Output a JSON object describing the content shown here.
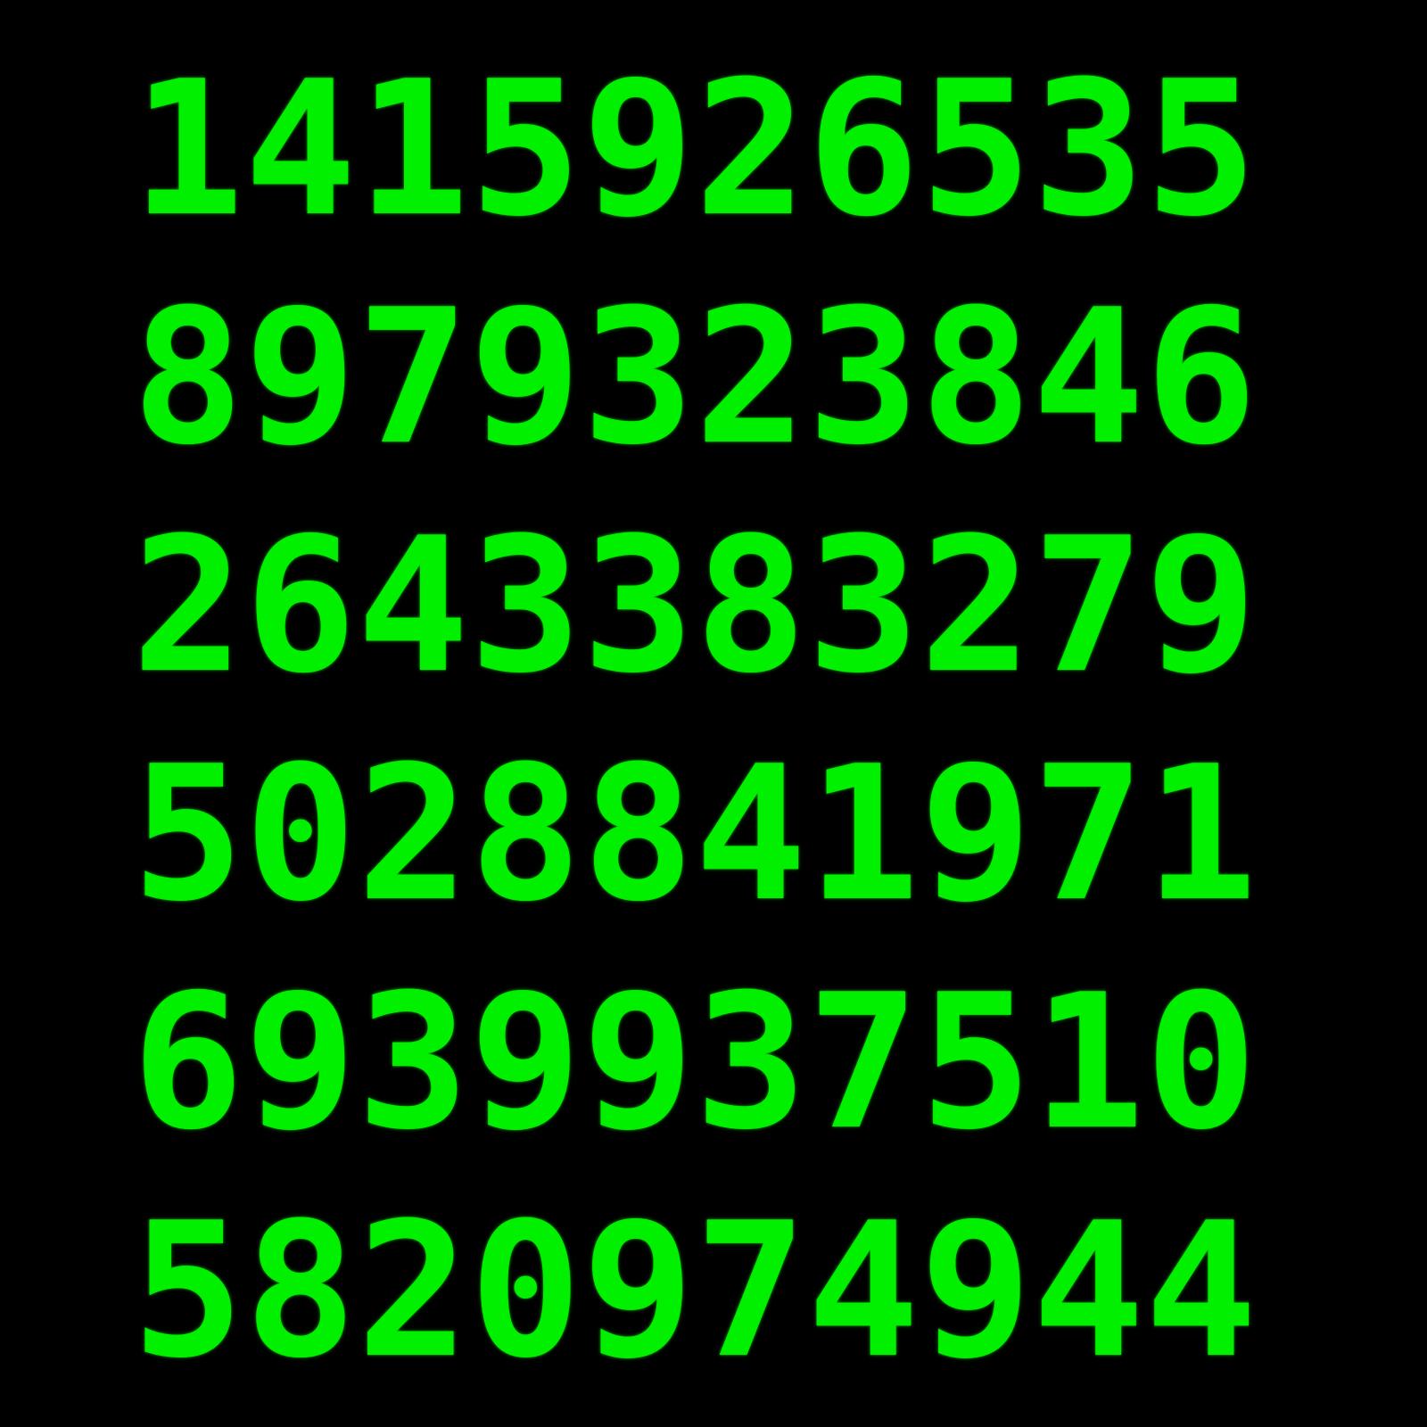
{
  "terminal": {
    "text_color": "#00f000",
    "background_color": "#000000",
    "lines": [
      "1415926535",
      "8979323846",
      "2643383279",
      "5028841971",
      "6939937510",
      "5820974944"
    ]
  }
}
